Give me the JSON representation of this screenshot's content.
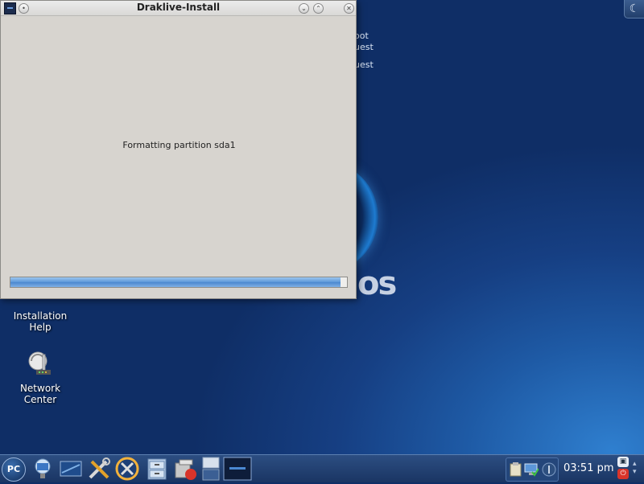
{
  "window": {
    "title": "Draklive-Install",
    "message": "Formatting partition sda1",
    "progress_fraction": 0.98
  },
  "desktop": {
    "partial_texts": [
      "oot",
      "uest",
      "uest"
    ],
    "logo_partial": "os",
    "icons": [
      {
        "label_line1": "Installation",
        "label_line2": "Help",
        "icon": "help-lifebuoy-icon"
      },
      {
        "label_line1": "Network",
        "label_line2": "Center",
        "icon": "network-center-icon"
      }
    ]
  },
  "taskbar": {
    "menu_label": "PC",
    "clock": "03:51 pm",
    "launchers": [
      "remote-desktop-icon",
      "display-settings-icon",
      "tools-icon",
      "installer-icon",
      "file-cabinet-icon",
      "software-package-icon",
      "pager-icon",
      "task-draklive-icon"
    ],
    "tray_icons": [
      "clipboard-icon",
      "network-status-icon",
      "update-icon"
    ]
  },
  "colors": {
    "accent": "#5b97d9",
    "desktop_bg": "#163f83",
    "power": "#d9342a"
  }
}
